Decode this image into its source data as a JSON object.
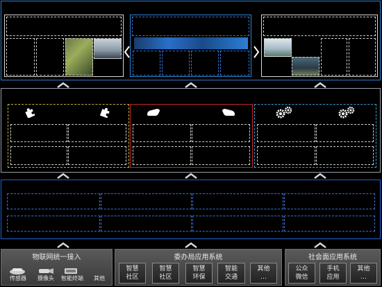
{
  "top_layer": {
    "carousel_prev_icon": "chevron-left",
    "carousel_next_icon": "chevron-right"
  },
  "middle_layer": {
    "icons": [
      "puzzle",
      "puzzle",
      "cloud-hand",
      "cloud-hand",
      "gears",
      "gears"
    ]
  },
  "bottom_bar": {
    "iot": {
      "title": "物联网统一接入",
      "devices": [
        "传感器",
        "摄像头",
        "智能终端",
        "其他"
      ]
    },
    "office": {
      "title": "委办局应用系统",
      "tiles": [
        "智慧\n社区",
        "智慧\n社区",
        "智慧\n环保",
        "智能\n交通",
        "其他\n…"
      ]
    },
    "social": {
      "title": "社会面应用系统",
      "tiles": [
        "公众\n微信",
        "手机\n应用",
        "其他\n…"
      ]
    }
  },
  "colors": {
    "top_frame": "#2f7fd0",
    "yellow": "#c8b43a",
    "red": "#c42828",
    "cyan": "#3aa0d8",
    "blue": "#1f63d8"
  }
}
